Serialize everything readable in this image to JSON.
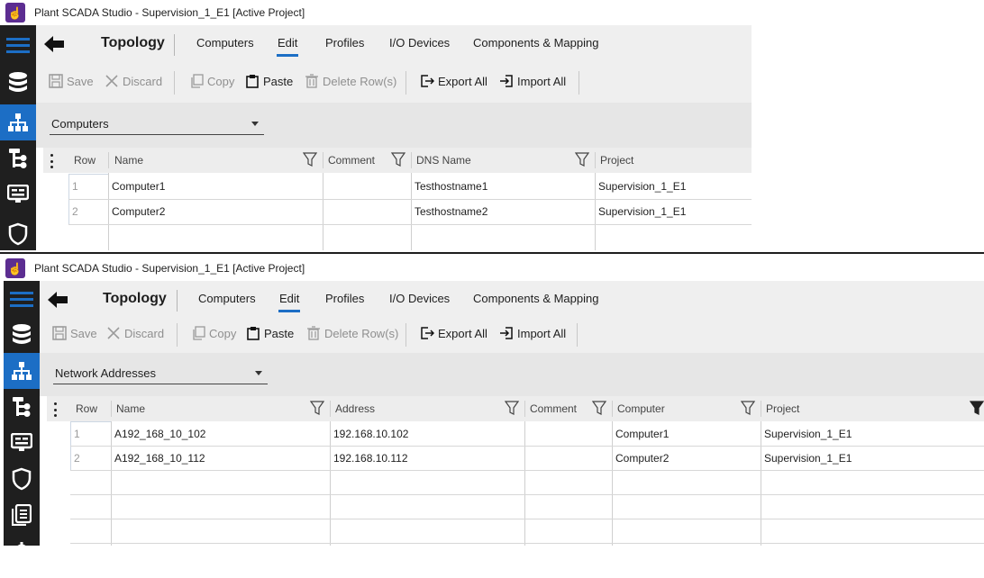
{
  "icons": {
    "app": "hand-pointer-icon",
    "menu": "hamburger-menu-icon",
    "back": "arrow-left-icon",
    "sidebar": [
      "database-icon",
      "topology-icon",
      "tree-icon",
      "display-page-icon",
      "shield-icon",
      "document-list-icon",
      "gear-icon"
    ],
    "toolbar": [
      "save-icon",
      "close-icon",
      "copy-icon",
      "paste-icon",
      "trash-icon",
      "export-icon",
      "import-icon"
    ],
    "filter": "filter-funnel-icon"
  },
  "colors": {
    "accent": "#1c6ec5",
    "sidebar": "#1f1f1f",
    "appIcon": "#5c2d91"
  },
  "window1": {
    "title": "Plant SCADA Studio - Supervision_1_E1 [Active Project]",
    "nav": {
      "title": "Topology",
      "tabs": [
        "Computers",
        "Edit",
        "Profiles",
        "I/O Devices",
        "Components & Mapping"
      ],
      "active_tab": "Edit"
    },
    "toolbar": {
      "save": "Save",
      "discard": "Discard",
      "copy": "Copy",
      "paste": "Paste",
      "delete_rows": "Delete Row(s)",
      "export_all": "Export All",
      "import_all": "Import All"
    },
    "selector": "Computers",
    "grid": {
      "columns": [
        "Row",
        "Name",
        "Comment",
        "DNS Name",
        "Project"
      ],
      "rows": [
        [
          "1",
          "Computer1",
          "",
          "Testhostname1",
          "Supervision_1_E1"
        ],
        [
          "2",
          "Computer2",
          "",
          "Testhostname2",
          "Supervision_1_E1"
        ]
      ]
    }
  },
  "window2": {
    "title": "Plant SCADA Studio - Supervision_1_E1 [Active Project]",
    "nav": {
      "title": "Topology",
      "tabs": [
        "Computers",
        "Edit",
        "Profiles",
        "I/O Devices",
        "Components & Mapping"
      ],
      "active_tab": "Edit"
    },
    "toolbar": {
      "save": "Save",
      "discard": "Discard",
      "copy": "Copy",
      "paste": "Paste",
      "delete_rows": "Delete Row(s)",
      "export_all": "Export All",
      "import_all": "Import All"
    },
    "selector": "Network Addresses",
    "grid": {
      "columns": [
        "Row",
        "Name",
        "Address",
        "Comment",
        "Computer",
        "Project"
      ],
      "rows": [
        [
          "1",
          "A192_168_10_102",
          "192.168.10.102",
          "",
          "Computer1",
          "Supervision_1_E1"
        ],
        [
          "2",
          "A192_168_10_112",
          "192.168.10.112",
          "",
          "Computer2",
          "Supervision_1_E1"
        ]
      ]
    }
  }
}
